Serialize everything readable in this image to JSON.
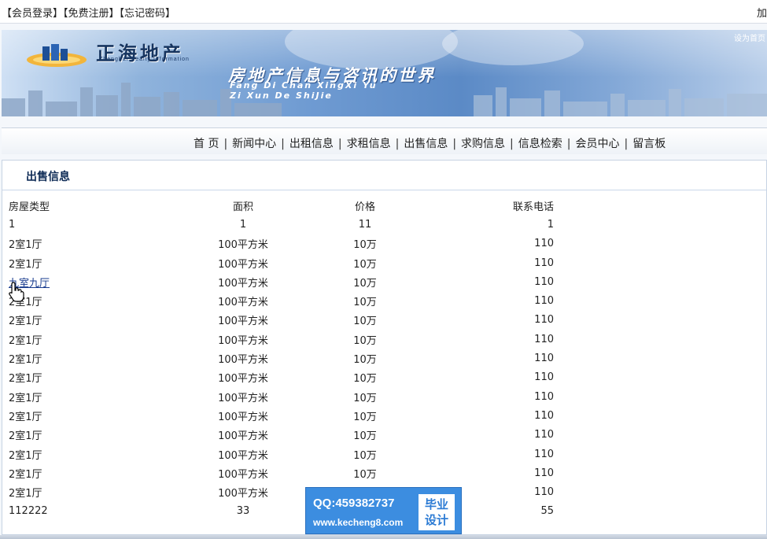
{
  "topbar": {
    "links": [
      "【会员登录】",
      "【免费注册】",
      "【忘记密码】"
    ],
    "right_text": "加"
  },
  "banner": {
    "logo_text": "正海地产",
    "logo_sub": "Zhenghai Realty Information",
    "slogan": "房地产信息与咨讯的世界",
    "slogan_pinyin_1": "Fang Di Chan XingXi Yu",
    "slogan_pinyin_2": "Zi Xun De ShiJie",
    "corner_text": "设为首页"
  },
  "nav": {
    "items": [
      "首 页",
      "新闻中心",
      "出租信息",
      "求租信息",
      "出售信息",
      "求购信息",
      "信息检索",
      "会员中心",
      "留言板"
    ]
  },
  "panel": {
    "title": "出售信息",
    "columns": [
      "房屋类型",
      "面积",
      "价格",
      "联系电话"
    ],
    "rows": [
      [
        "1",
        "1",
        "11",
        "1"
      ],
      [
        "2室1厅",
        "100平方米",
        "10万",
        "110"
      ],
      [
        "2室1厅",
        "100平方米",
        "10万",
        "110"
      ],
      [
        "九室九厅",
        "100平方米",
        "10万",
        "110"
      ],
      [
        "2室1厅",
        "100平方米",
        "10万",
        "110"
      ],
      [
        "2室1厅",
        "100平方米",
        "10万",
        "110"
      ],
      [
        "2室1厅",
        "100平方米",
        "10万",
        "110"
      ],
      [
        "2室1厅",
        "100平方米",
        "10万",
        "110"
      ],
      [
        "2室1厅",
        "100平方米",
        "10万",
        "110"
      ],
      [
        "2室1厅",
        "100平方米",
        "10万",
        "110"
      ],
      [
        "2室1厅",
        "100平方米",
        "10万",
        "110"
      ],
      [
        "2室1厅",
        "100平方米",
        "10万",
        "110"
      ],
      [
        "2室1厅",
        "100平方米",
        "10万",
        "110"
      ],
      [
        "2室1厅",
        "100平方米",
        "10万",
        "110"
      ],
      [
        "2室1厅",
        "100平方米",
        "10万",
        "110"
      ],
      [
        "112222",
        "33",
        "",
        "55"
      ]
    ],
    "hovered_row": 3
  },
  "watermark": {
    "qq": "QQ:459382737",
    "url": "www.kecheng8.com",
    "badge_line1": "毕业",
    "badge_line2": "设计"
  }
}
